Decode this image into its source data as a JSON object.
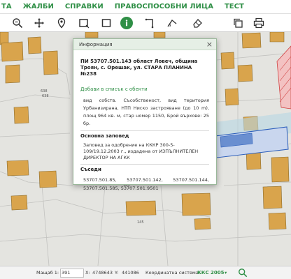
{
  "nav": {
    "items": [
      "ТА",
      "ЖАЛБИ",
      "СПРАВКИ",
      "ПРАВОСПОСОБНИ ЛИЦА",
      "ТЕСТ"
    ]
  },
  "toolbar": {
    "tools": [
      "zoom-out-icon",
      "pan-icon",
      "location-pin-icon",
      "select-rect-icon",
      "rectangle-icon",
      "info-icon",
      "line-icon",
      "angle-icon",
      "eraser-icon",
      "copy-icon",
      "print-icon"
    ],
    "accent_color": "#2f8f46"
  },
  "map": {
    "labels": {
      "l1": "638",
      "l2": "638",
      "l3": "145",
      "l4": "145"
    },
    "parcel_fill": "#d9a44c",
    "selected_fill": "#6a8fd0"
  },
  "dialog": {
    "title": "Информация",
    "close": "×",
    "property_title": "ПИ 53707.501.143 област Ловеч, община Троян, с. Орешак, ул. СТАРА ПЛАНИНА №238",
    "add_link": "Добави в списък с обекти",
    "description": "вид собств. Съсобственост, вид територия Урбанизирана, НТП Ниско застрояване (до 10 m), площ 964 кв. м, стар номер 1150, Брой върхове: 25 бр.",
    "order_title": "Основна заповед",
    "order_text": "Заповед за одобрение на КККР 300-5-109/19.12.2003 г., издадена от ИЗПЪЛНИТЕЛЕН ДИРЕКТОР НА АГКК",
    "neighbours_title": "Съседи",
    "neighbours_row1": [
      "53707.501.85,",
      "53707.501.142,",
      "53707.501.144,"
    ],
    "neighbours_row2": "53707.501.585, 53707.501.9501"
  },
  "status": {
    "scale_label": "Мащаб 1:",
    "scale_value": "391",
    "x_label": "X:",
    "x_value": "4748643",
    "y_label": "Y:",
    "y_value": "441086",
    "crs_label": "Координатна система:",
    "crs_value": "ККС 2005"
  }
}
